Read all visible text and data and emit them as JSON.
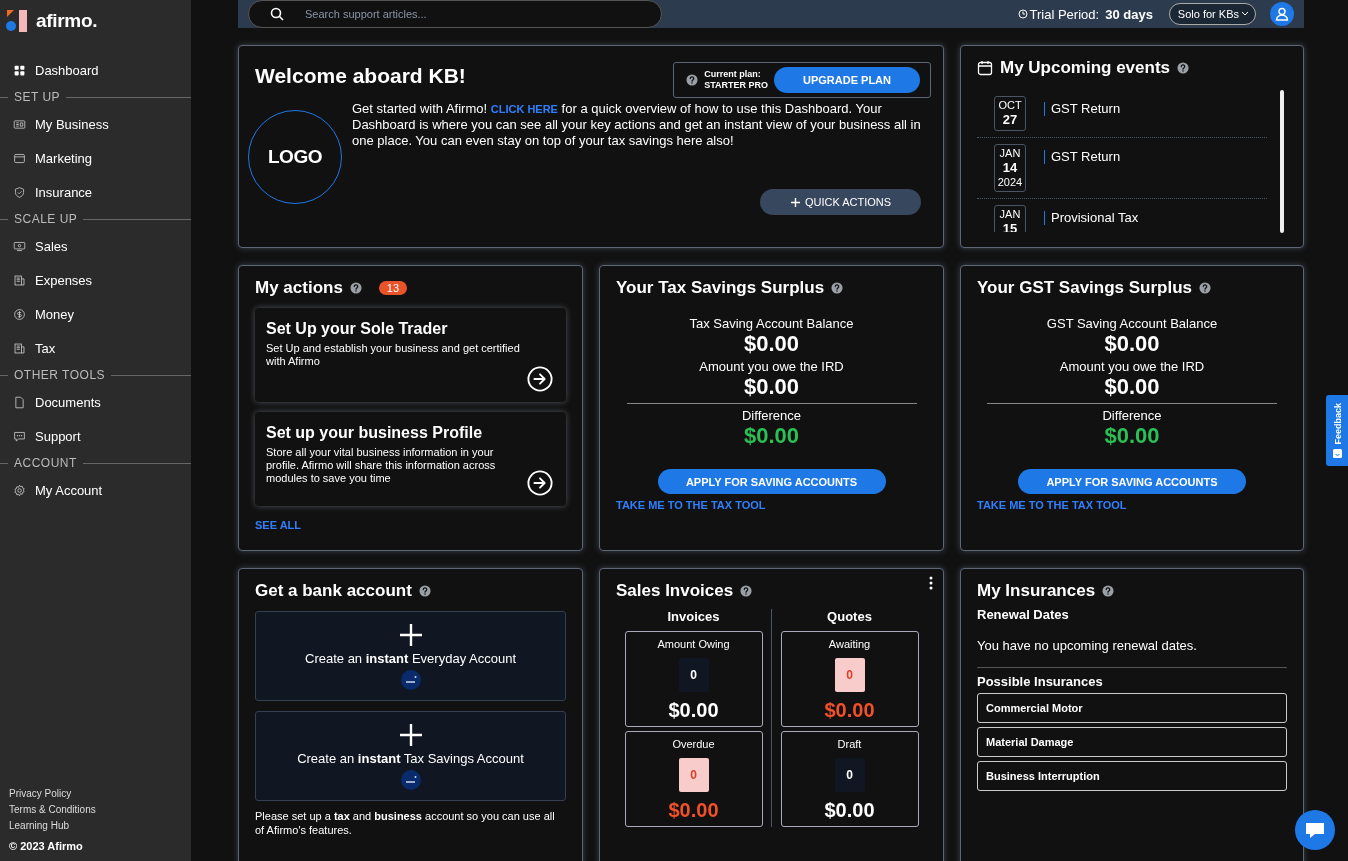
{
  "sidebar": {
    "brand": "afirmo.",
    "groups": [
      {
        "items": [
          {
            "label": "Dashboard"
          }
        ]
      },
      {
        "heading": "SET UP",
        "items": [
          {
            "label": "My Business"
          },
          {
            "label": "Marketing"
          },
          {
            "label": "Insurance"
          }
        ]
      },
      {
        "heading": "SCALE UP",
        "items": [
          {
            "label": "Sales"
          },
          {
            "label": "Expenses"
          },
          {
            "label": "Money"
          },
          {
            "label": "Tax"
          }
        ]
      },
      {
        "heading": "OTHER TOOLS",
        "items": [
          {
            "label": "Documents"
          },
          {
            "label": "Support"
          }
        ]
      },
      {
        "heading": "ACCOUNT",
        "items": [
          {
            "label": "My Account"
          }
        ]
      }
    ],
    "footer_links": [
      "Privacy Policy",
      "Terms & Conditions",
      "Learning Hub"
    ],
    "copyright": "© 2023 Afirmo"
  },
  "topbar": {
    "search": {
      "placeholder": "Search support articles..."
    },
    "trial_label": "Trial Period:",
    "trial_value": "30 days",
    "account": "Solo for KBs"
  },
  "welcome": {
    "title": "Welcome aboard KB!",
    "plan_label": "Current plan:",
    "plan_name": "STARTER PRO",
    "upgrade": "UPGRADE PLAN",
    "logo": "LOGO",
    "intro_before": "Get started with Afirmo!",
    "intro_link": "CLICK HERE",
    "intro_after": "for a quick overview of how to use this Dashboard. Your Dashboard is where you can see all your key actions and get an instant view of your business all in one place. You can even stay on top of your tax savings here also!",
    "quick_actions": "QUICK ACTIONS"
  },
  "events": {
    "title": "My Upcoming events",
    "items": [
      {
        "month": "OCT",
        "day": "27",
        "title": "GST Return"
      },
      {
        "month": "JAN",
        "day": "14",
        "year": "2024",
        "title": "GST Return"
      },
      {
        "month": "JAN",
        "day": "15",
        "title": "Provisional Tax"
      }
    ]
  },
  "actions": {
    "title": "My actions",
    "count": "13",
    "items": [
      {
        "title": "Set Up your Sole Trader",
        "text": "Set Up and establish your business and get certified with Afirmo"
      },
      {
        "title": "Set up your business Profile",
        "text": "Store all your vital business information in your profile. Afirmo will share this information across modules to save you time"
      }
    ],
    "see_all": "SEE ALL"
  },
  "surpluses": [
    {
      "title": "Your Tax Savings Surplus",
      "balance_label": "Tax Saving Account Balance",
      "balance": "$0.00",
      "owe_label": "Amount you owe the IRD",
      "owe": "$0.00",
      "diff_label": "Difference",
      "diff": "$0.00",
      "button": "APPLY FOR SAVING ACCOUNTS",
      "link": "TAKE ME TO THE TAX TOOL"
    },
    {
      "title": "Your GST Savings Surplus",
      "balance_label": "GST Saving Account Balance",
      "balance": "$0.00",
      "owe_label": "Amount you owe the IRD",
      "owe": "$0.00",
      "diff_label": "Difference",
      "diff": "$0.00",
      "button": "APPLY FOR SAVING ACCOUNTS",
      "link": "TAKE ME TO THE TAX TOOL"
    }
  ],
  "bank": {
    "title": "Get a bank account",
    "tiles": [
      "Create an **instant** Everyday Account",
      "Create an **instant** Tax Savings Account"
    ],
    "note": "Please set up a **tax** and **business** account so you can use all of Afirmo's features."
  },
  "sales": {
    "title": "Sales Invoices",
    "columns": [
      {
        "heading": "Invoices",
        "tiles": [
          {
            "label": "Amount Owing",
            "count": "0",
            "amount": "$0.00",
            "alert": false
          },
          {
            "label": "Overdue",
            "count": "0",
            "amount": "$0.00",
            "alert": true
          }
        ]
      },
      {
        "heading": "Quotes",
        "tiles": [
          {
            "label": "Awaiting",
            "count": "0",
            "amount": "$0.00",
            "alert": true
          },
          {
            "label": "Draft",
            "count": "0",
            "amount": "$0.00",
            "alert": false
          }
        ]
      }
    ]
  },
  "insurance": {
    "title": "My Insurances",
    "renewal_heading": "Renewal Dates",
    "renewal_text": "You have no upcoming renewal dates.",
    "possible_heading": "Possible Insurances",
    "items": [
      "Commercial Motor",
      "Material Damage",
      "Business Interruption"
    ]
  },
  "feedback": "Feedback"
}
